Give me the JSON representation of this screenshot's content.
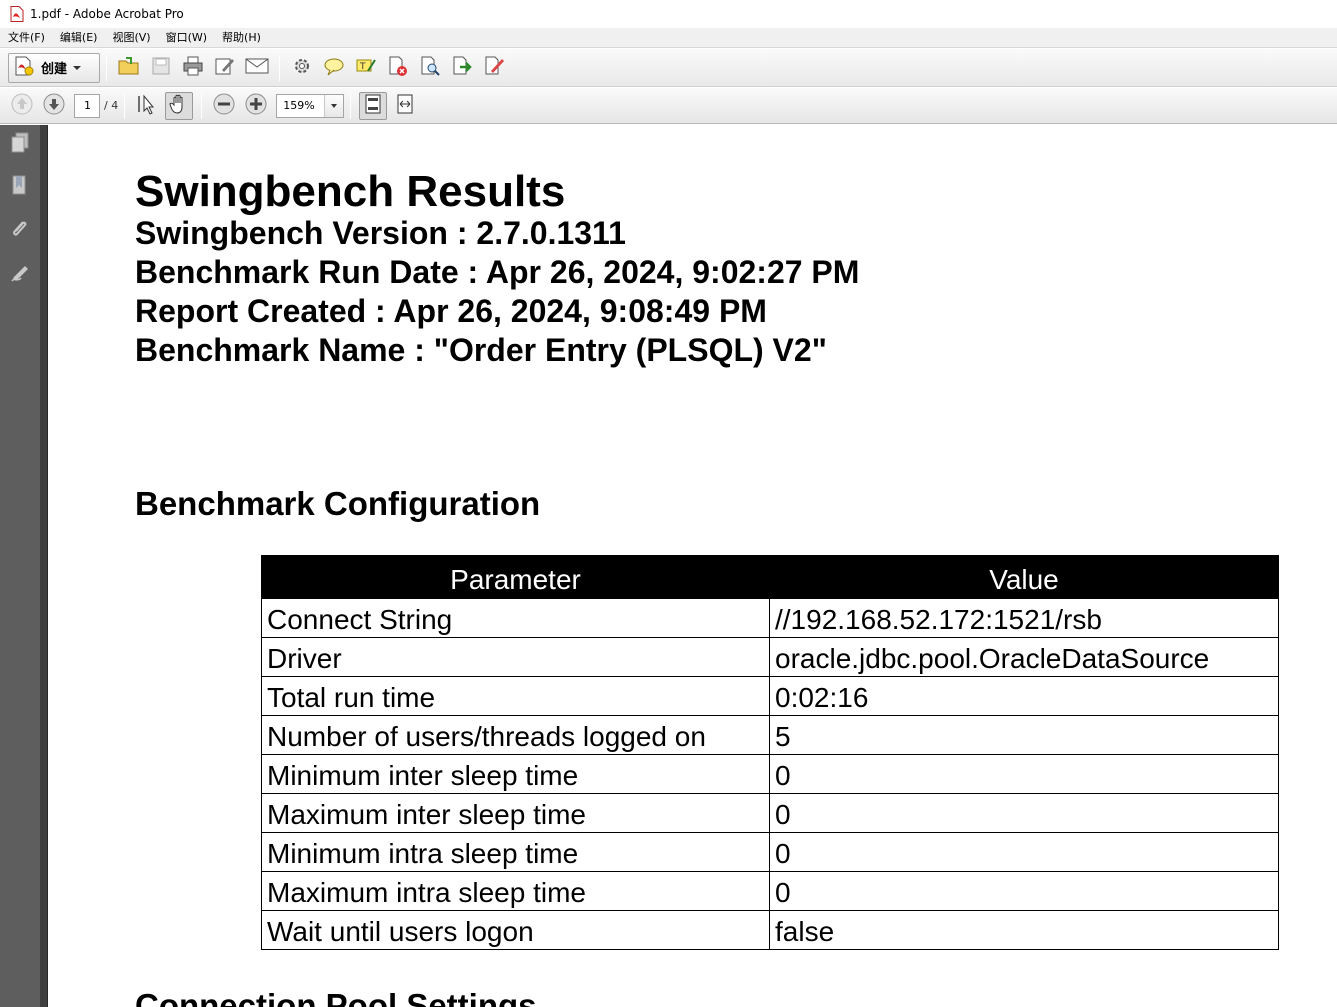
{
  "window": {
    "title": "1.pdf - Adobe Acrobat Pro"
  },
  "menubar": {
    "items": [
      "文件(F)",
      "编辑(E)",
      "视图(V)",
      "窗口(W)",
      "帮助(H)"
    ]
  },
  "toolbar": {
    "create_label": "创建",
    "page_current": "1",
    "page_total": "/ 4",
    "zoom_value": "159%"
  },
  "document": {
    "title": "Swingbench Results",
    "meta": [
      "Swingbench Version : 2.7.0.1311",
      "Benchmark Run Date : Apr 26, 2024, 9:02:27 PM",
      "Report Created : Apr 26, 2024, 9:08:49 PM",
      "Benchmark Name : \"Order Entry (PLSQL) V2\""
    ],
    "section_config": "Benchmark Configuration",
    "section_pool": "Connection Pool Settings",
    "table": {
      "headers": [
        "Parameter",
        "Value"
      ],
      "rows": [
        [
          "Connect String",
          "//192.168.52.172:1521/rsb"
        ],
        [
          "Driver",
          "oracle.jdbc.pool.OracleDataSource"
        ],
        [
          "Total run time",
          "0:02:16"
        ],
        [
          "Number of users/threads logged on",
          "5"
        ],
        [
          "Minimum inter sleep time",
          "0"
        ],
        [
          "Maximum inter sleep time",
          "0"
        ],
        [
          "Minimum intra sleep time",
          "0"
        ],
        [
          "Maximum intra sleep time",
          "0"
        ],
        [
          "Wait until users logon",
          "false"
        ]
      ]
    }
  }
}
